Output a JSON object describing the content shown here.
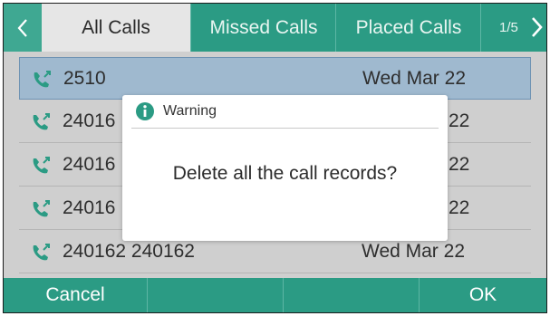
{
  "tabs": {
    "items": [
      {
        "label": "All Calls",
        "active": true
      },
      {
        "label": "Missed Calls",
        "active": false
      },
      {
        "label": "Placed Calls",
        "active": false
      }
    ],
    "page_indicator": "1/5"
  },
  "call_list": {
    "rows": [
      {
        "name": "2510",
        "date": "Wed Mar 22",
        "selected": true
      },
      {
        "name": "24016",
        "date": "22",
        "selected": false
      },
      {
        "name": "24016",
        "date": "22",
        "selected": false
      },
      {
        "name": "24016",
        "date": "22",
        "selected": false
      },
      {
        "name": "240162 240162",
        "date": "Wed Mar 22",
        "selected": false
      }
    ]
  },
  "dialog": {
    "title": "Warning",
    "message": "Delete all the call records?"
  },
  "softkeys": {
    "cancel_label": "Cancel",
    "ok_label": "OK"
  },
  "colors": {
    "accent_green": "#2b9b84",
    "selected_row": "#9fb9cf",
    "call_icon": "#2b9b84",
    "info_icon": "#2b9b84"
  },
  "icons": {
    "left": "chevron-left-icon",
    "right": "chevron-right-icon",
    "row": "call-log-icon",
    "dialog": "info-icon"
  }
}
